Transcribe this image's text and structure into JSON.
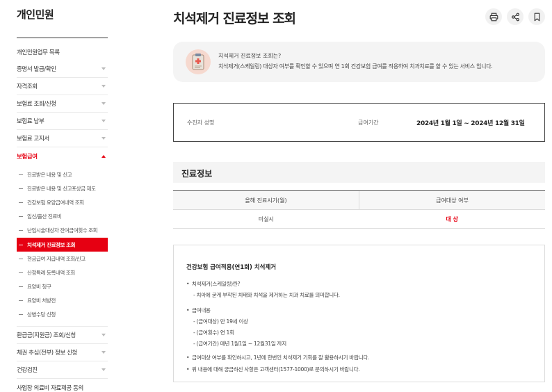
{
  "sidebar": {
    "title": "개인민원",
    "top_link": "개인민원업무 목록",
    "items_before": [
      "증명서 발급/확인",
      "자격조회",
      "보험료 조회/신청",
      "보험료 납부",
      "보험료 고지서"
    ],
    "active_item": "보험급여",
    "sub_items_before": [
      "진료받은 내용 및 신고",
      "진료받은 내용 및 신고포상금 제도",
      "건강보험 요양급여내역 조회",
      "임신/출산 진료비",
      "난임시술대상자 잔여급여횟수 조회"
    ],
    "sub_active": "치석제거 진료정보 조회",
    "sub_items_after": [
      "현금급여 지급내역 조회/신고",
      "산정특례 등록내역 조회",
      "요양비 청구",
      "요양비 처방전",
      "상병수당 신청"
    ],
    "items_after": [
      "환급금(지원금) 조회/신청",
      "체권 추심(전부) 정보 신청",
      "건강검진",
      "사업장 의료비 자료제공 동의"
    ]
  },
  "header": {
    "title": "치석제거 진료정보 조회",
    "tools": [
      "print-icon",
      "share-icon",
      "bookmark-icon"
    ]
  },
  "info": {
    "question": "치석제거 진료정보 조회는?",
    "answer": "치석제거(스케일링) 대상자 여부를 확인할 수 있으며 연 1회 건강보험 급여를 적용하여 치과치료를 할 수 있는 서비스 입니다."
  },
  "summary": {
    "patient_label": "수진자 성명",
    "patient_value": "",
    "period_label": "급여기간",
    "period_value": "2024년 1월 1일 ~ 2024년 12월 31일"
  },
  "section": {
    "title": "진료정보",
    "columns": [
      "올해 진료시기(월)",
      "급여대상 여부"
    ],
    "rows": [
      [
        "미실시",
        "대 상"
      ]
    ]
  },
  "notice": {
    "title": "건강보험 급여적용(연1회) 치석제거",
    "q1": "치석제거(스케일링)란?",
    "q1_desc": "- 치아에 굳게 부착된 치태와 치석을 제거하는 치과 치료를 의미합니다.",
    "q2": "급여내용",
    "q2_lines": [
      "- (급여대상) 만 19세 이상",
      "- (급여횟수) 연 1회",
      "- (급여기간) 매년 1월1일 ~ 12월31일 까지"
    ],
    "b3": "급여대상 여부를 확인하시고, 1년에 한번인 치석제거 기회를 잘 활용하시기 바랍니다.",
    "b4": "위 내용에 대해 궁금하신 사항은 고객센터(1577-1000)로 문의하시기 바랍니다."
  },
  "colors": {
    "accent": "#e60012",
    "panel_bg": "#f4f4f4"
  }
}
